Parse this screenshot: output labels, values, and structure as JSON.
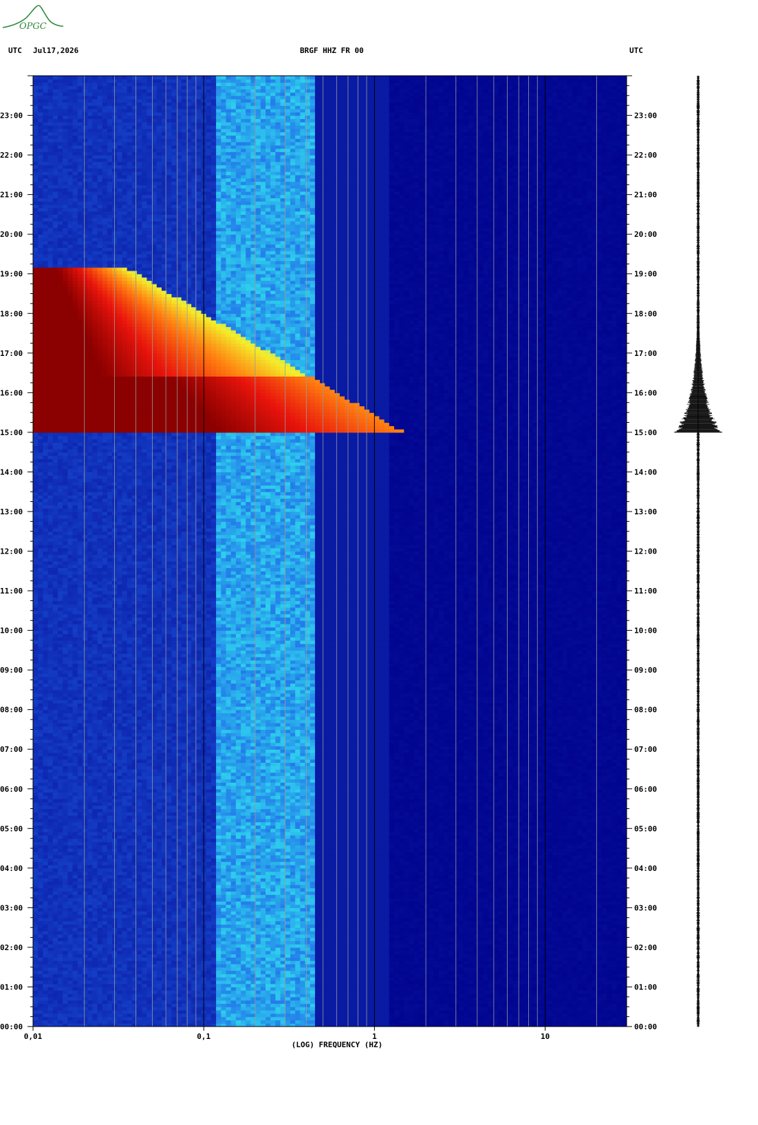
{
  "header": {
    "left_tz": "UTC",
    "date": "Jul17,2026",
    "station": "BRGF HHZ FR 00",
    "right_tz": "UTC"
  },
  "logo": {
    "text": "OPGC",
    "color": "#2e8b3a"
  },
  "colors": {
    "background": "#00008b",
    "low": "#0b1fa8",
    "mid": "#1f5fe8",
    "cyan": "#2fd6ee",
    "yellow": "#f4ee2a",
    "orange": "#ff7a10",
    "red": "#e8140c",
    "saturated": "#8b0000"
  },
  "chart_data": {
    "type": "heatmap",
    "x_axis_kind": "log",
    "xlabel": "(LOG) FREQUENCY (HZ)",
    "xlim_hz": [
      0.01,
      30
    ],
    "x_tick_labels": [
      {
        "value": 0.01,
        "label": "0,01"
      },
      {
        "value": 0.1,
        "label": "0,1"
      },
      {
        "value": 1,
        "label": "1"
      },
      {
        "value": 10,
        "label": "10"
      }
    ],
    "y_axis_kind": "time_utc_hours",
    "ylim_hours": [
      0,
      24
    ],
    "y_tick_labels": [
      "00:00",
      "01:00",
      "02:00",
      "03:00",
      "04:00",
      "05:00",
      "06:00",
      "07:00",
      "08:00",
      "09:00",
      "10:00",
      "11:00",
      "12:00",
      "13:00",
      "14:00",
      "15:00",
      "16:00",
      "17:00",
      "18:00",
      "19:00",
      "20:00",
      "21:00",
      "22:00",
      "23:00"
    ],
    "grid": true,
    "event": {
      "start_hour": 15.0,
      "peak_end_hour": 16.4,
      "coda_end_hour": 19.2,
      "max_frequency_hz": 1.5
    },
    "background_band_hz": [
      0.12,
      0.45
    ],
    "trace_side": "right"
  }
}
